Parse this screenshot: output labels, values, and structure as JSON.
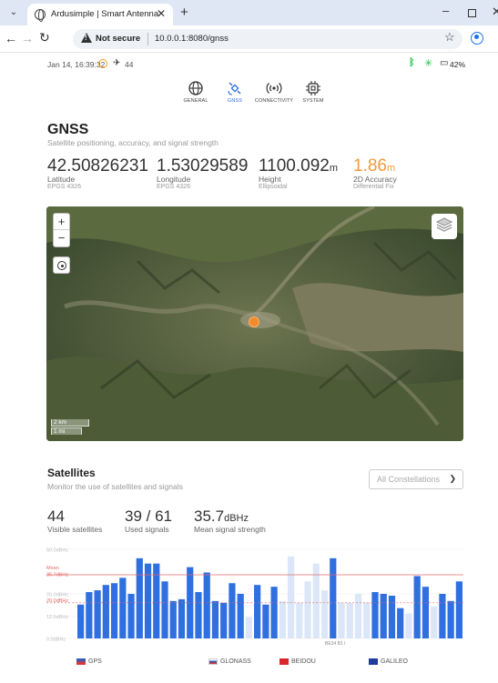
{
  "browser": {
    "tab_title": "Ardusimple | Smart Antenna",
    "not_secure": "Not secure",
    "url": "10.0.0.1:8080/gnss"
  },
  "status": {
    "datetime": "Jan 14, 16:39:32",
    "satellites": "44",
    "battery": "42%"
  },
  "nav": {
    "items": [
      {
        "label": "GENERAL",
        "icon": "globe-icon"
      },
      {
        "label": "GNSS",
        "icon": "satellite-icon"
      },
      {
        "label": "CONNECTIVITY",
        "icon": "broadcast-icon"
      },
      {
        "label": "SYSTEM",
        "icon": "chip-icon"
      }
    ],
    "active": "GNSS"
  },
  "gnss": {
    "title": "GNSS",
    "subtitle": "Satellite positioning, accuracy, and signal strength",
    "metrics": [
      {
        "value": "42.50826231",
        "unit": "",
        "name": "Latitude",
        "sub": "EPGS 4326"
      },
      {
        "value": "1.53029589",
        "unit": "",
        "name": "Longitude",
        "sub": "EPGS 4326"
      },
      {
        "value": "1100.092",
        "unit": "m",
        "name": "Height",
        "sub": "Ellipsoidal"
      },
      {
        "value": "1.86",
        "unit": "m",
        "name": "2D Accuracy",
        "sub": "Differential Fix"
      }
    ]
  },
  "map": {
    "zoom_in": "+",
    "zoom_out": "−",
    "scale_km": "2 km",
    "scale_mi": "1 mi"
  },
  "satellites": {
    "title": "Satellites",
    "subtitle": "Monitor the use of satellites and signals",
    "constellation_select": "All Constellations",
    "metrics": [
      {
        "value": "44",
        "unit": "",
        "name": "Visible satellites"
      },
      {
        "value": "39 / 61",
        "unit": "",
        "name": "Used signals"
      },
      {
        "value": "35.7",
        "unit": "dBHz",
        "name": "Mean signal strength"
      }
    ]
  },
  "colors": {
    "accent_orange": "#f39a3a",
    "bar_used": "#2f6fe0",
    "bar_unused": "#dbe6f8",
    "mean_line": "#e46a6a",
    "threshold_line": "#e46a6a"
  },
  "chart_data": {
    "type": "bar",
    "ylim": [
      0,
      50
    ],
    "y_ticks": [
      "50.0dBHz",
      "25.0dBHz",
      "12.5dBHz",
      "0.0dBHz"
    ],
    "y_tick_values": [
      50,
      25,
      12.5,
      0
    ],
    "mean_label": "Mean",
    "mean_value_label": "35.7dBHz",
    "mean": 35.7,
    "threshold_label": "20.0dBHz",
    "threshold": 20,
    "x_annotation": "BE34 B1 I",
    "values": [
      19,
      26,
      27,
      30,
      31,
      34,
      25,
      45,
      42,
      42,
      32,
      21,
      22,
      40,
      26,
      37,
      21,
      20,
      31,
      25,
      12,
      30,
      19,
      29,
      21,
      46,
      20,
      32,
      42,
      27,
      45,
      20,
      20,
      25,
      20,
      26,
      25,
      24,
      17,
      14,
      35,
      29,
      18,
      25,
      21,
      32
    ],
    "used": [
      1,
      1,
      1,
      1,
      1,
      1,
      1,
      1,
      1,
      1,
      1,
      1,
      1,
      1,
      1,
      1,
      1,
      1,
      1,
      1,
      0,
      1,
      1,
      1,
      0,
      0,
      0,
      0,
      0,
      0,
      1,
      0,
      0,
      0,
      0,
      1,
      1,
      1,
      1,
      0,
      1,
      1,
      0,
      1,
      1,
      1
    ],
    "legend": [
      "GPS",
      "GLONASS",
      "BEIDOU",
      "GALILEO"
    ]
  }
}
